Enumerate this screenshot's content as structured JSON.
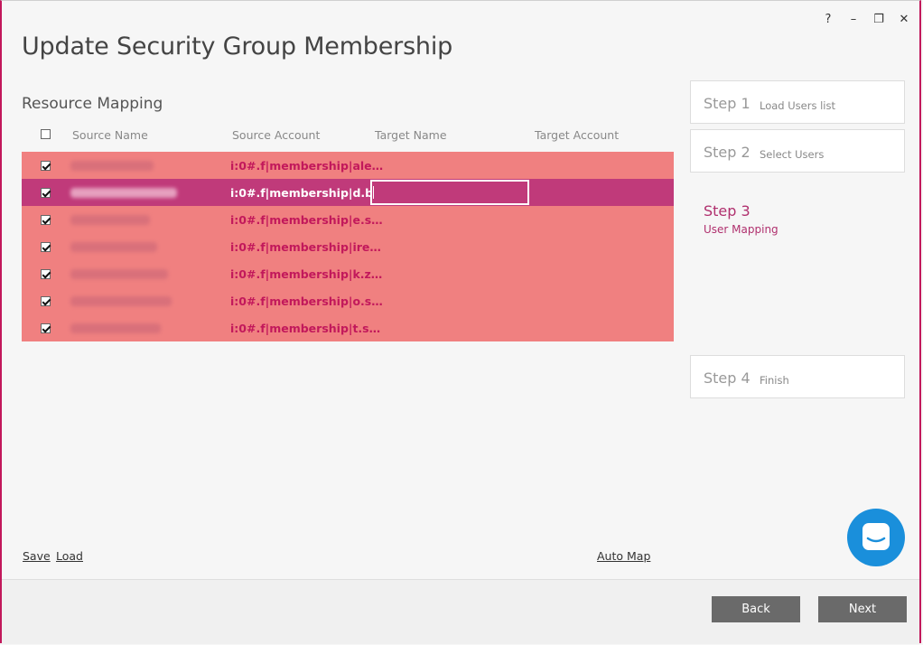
{
  "window": {
    "help_label": "?",
    "minimize_label": "–",
    "restore_label": "❐",
    "close_label": "✕"
  },
  "page": {
    "title": "Update Security Group Membership",
    "section_title": "Resource Mapping"
  },
  "table": {
    "headers": {
      "source_name": "Source Name",
      "source_account": "Source Account",
      "target_name": "Target Name",
      "target_account": "Target Account"
    },
    "rows": [
      {
        "checked": true,
        "source_account": "i:0#.f|membership|ale…",
        "selected": false
      },
      {
        "checked": true,
        "source_account": "i:0#.f|membership|d.b…",
        "selected": true
      },
      {
        "checked": true,
        "source_account": "i:0#.f|membership|e.s…",
        "selected": false
      },
      {
        "checked": true,
        "source_account": "i:0#.f|membership|ire…",
        "selected": false
      },
      {
        "checked": true,
        "source_account": "i:0#.f|membership|k.z…",
        "selected": false
      },
      {
        "checked": true,
        "source_account": "i:0#.f|membership|o.s…",
        "selected": false
      },
      {
        "checked": true,
        "source_account": "i:0#.f|membership|t.s…",
        "selected": false
      }
    ]
  },
  "links": {
    "save": "Save",
    "load": "Load",
    "auto_map": "Auto Map"
  },
  "steps": [
    {
      "num": "Step 1",
      "label": "Load Users list"
    },
    {
      "num": "Step 2",
      "label": "Select Users"
    },
    {
      "num": "Step 3",
      "label": "User Mapping"
    },
    {
      "num": "Step 4",
      "label": "Finish"
    }
  ],
  "buttons": {
    "back": "Back",
    "next": "Next"
  },
  "colors": {
    "accent": "#c2185b",
    "row_bg": "#f08080",
    "row_selected": "#c03a7a",
    "chat": "#1a8fdb"
  }
}
